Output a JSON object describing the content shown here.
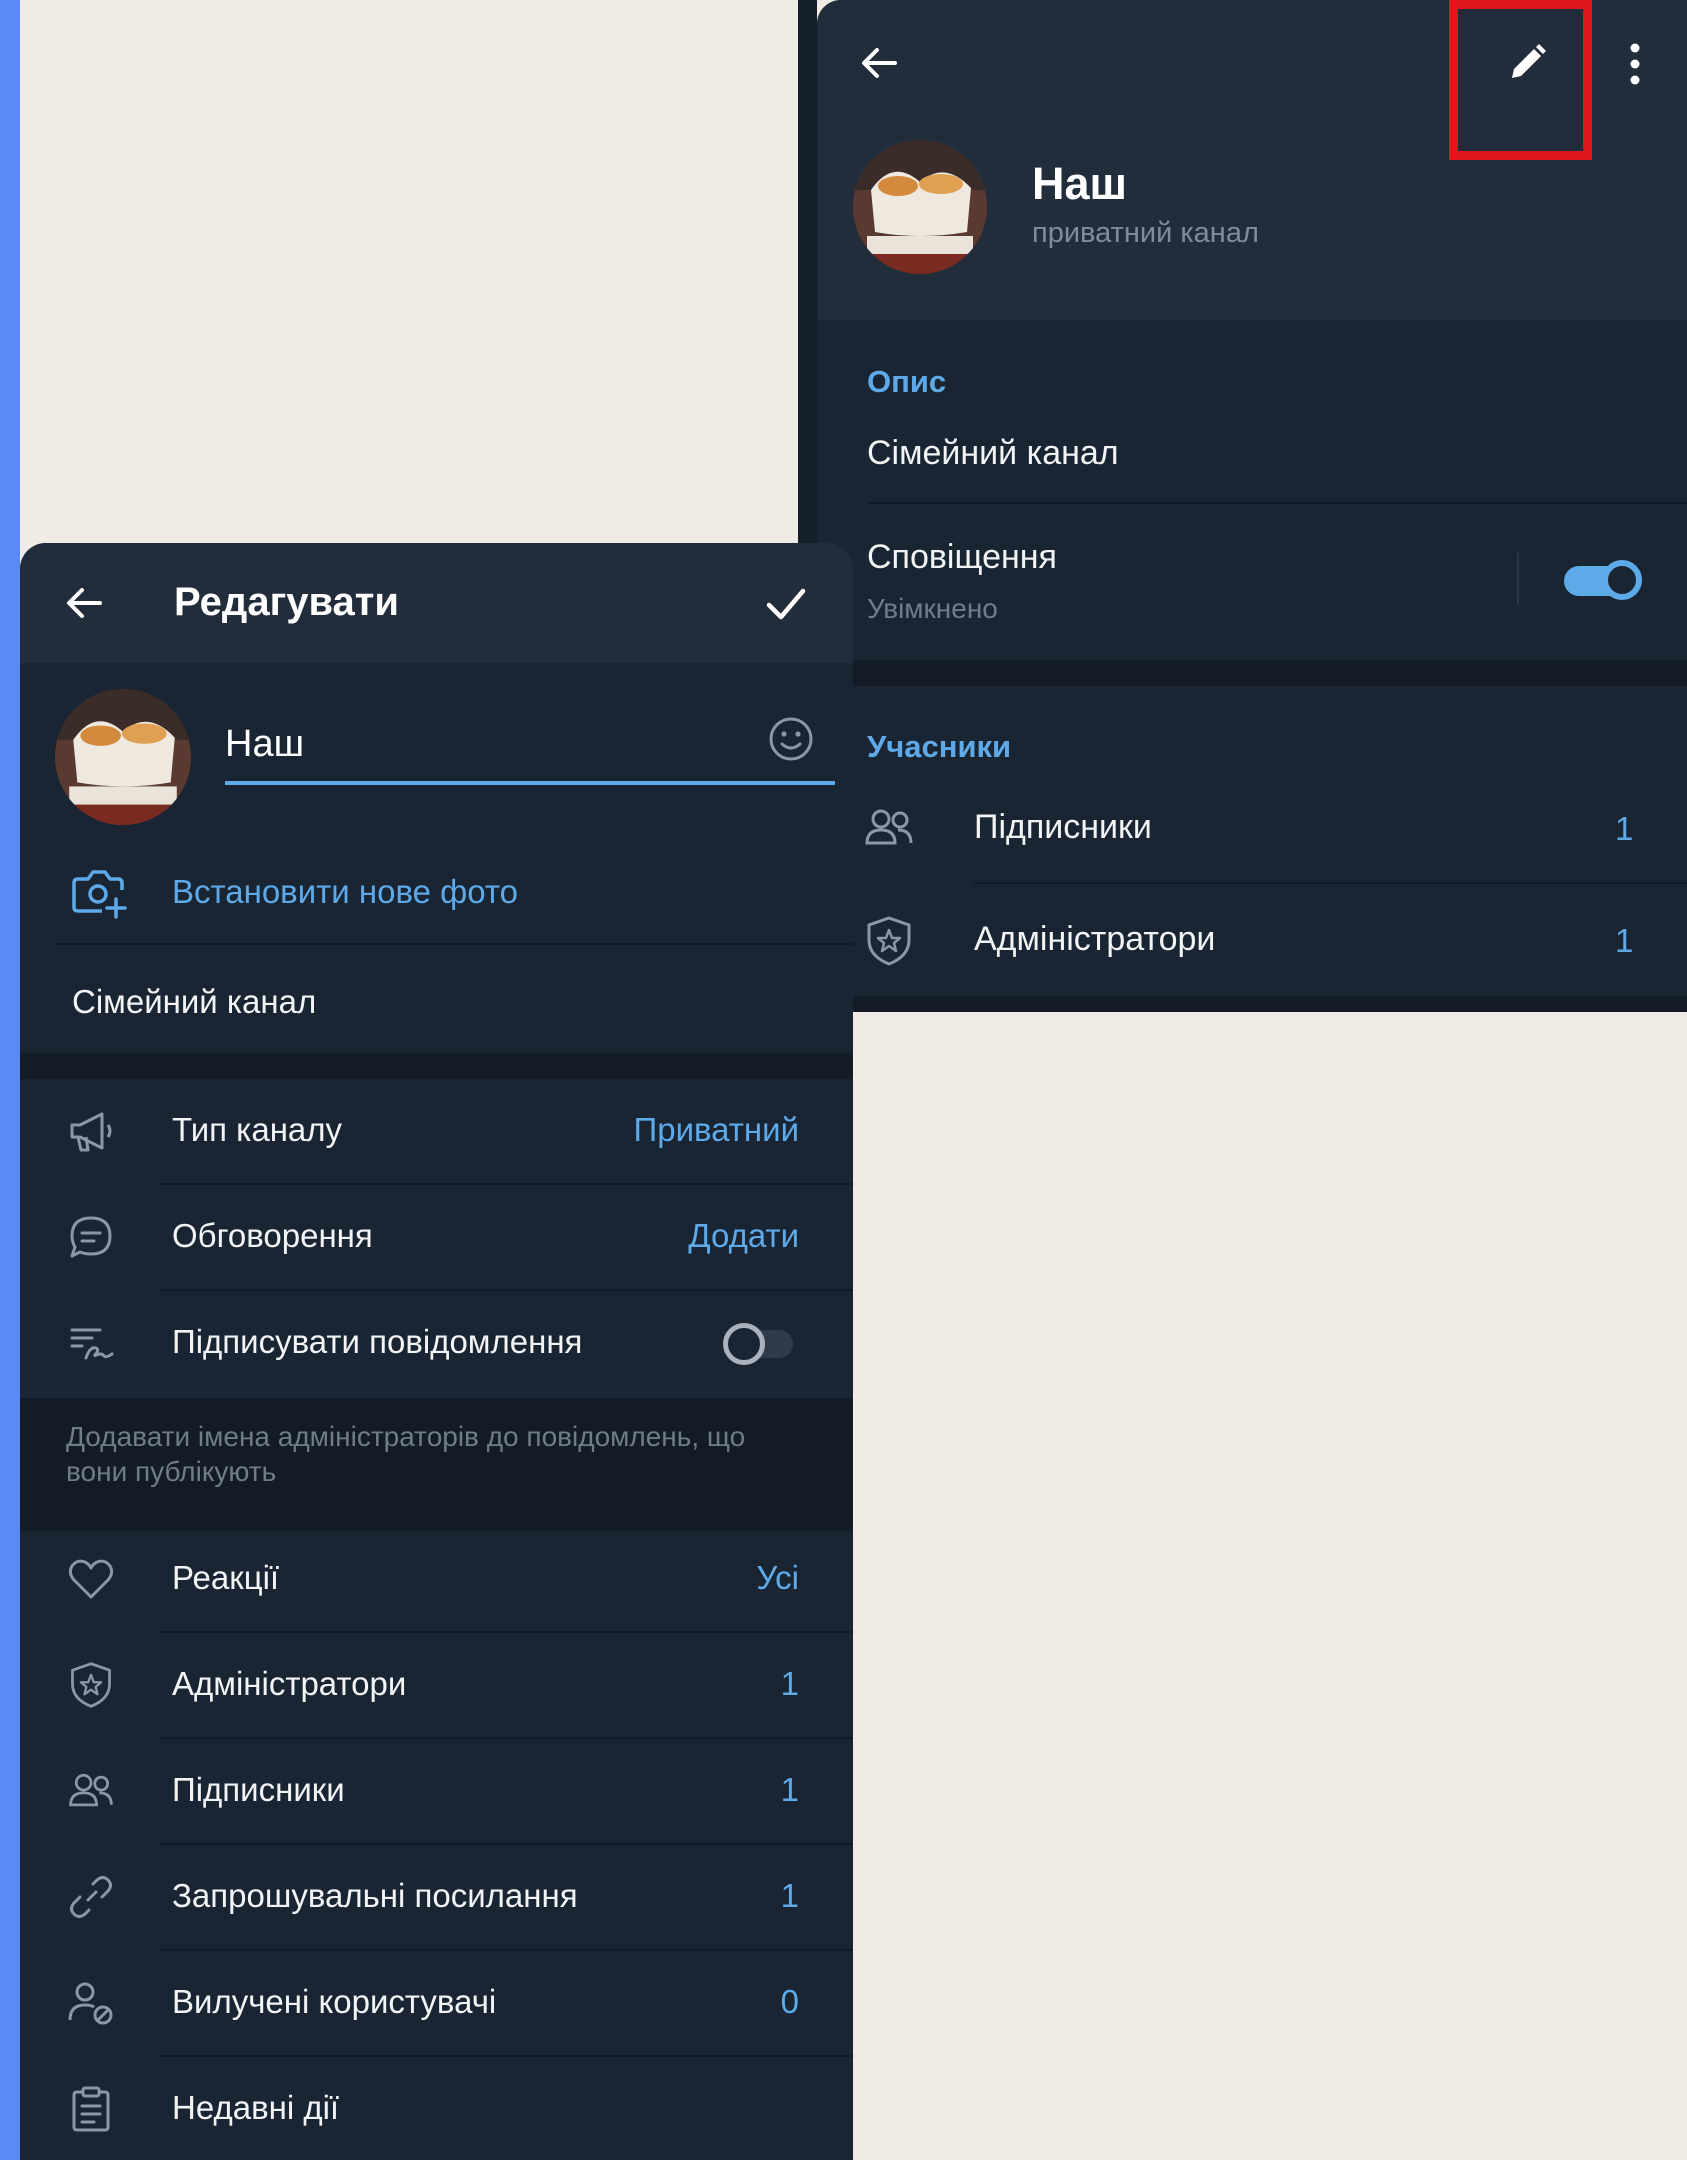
{
  "channel_info": {
    "name": "Наш",
    "subtitle": "приватний канал",
    "description_title": "Опис",
    "description": "Сімейний канал",
    "notifications_label": "Сповіщення",
    "notifications_status": "Увімкнено",
    "notifications_enabled": true,
    "members_title": "Учасники",
    "rows": [
      {
        "label": "Підписники",
        "count": "1",
        "icon": "subscribers-icon"
      },
      {
        "label": "Адміністратори",
        "count": "1",
        "icon": "admin-shield-icon"
      }
    ]
  },
  "edit_screen": {
    "title": "Редагувати",
    "name_value": "Наш",
    "set_photo_label": "Встановити нове фото",
    "description_value": "Сімейний канал",
    "settings": [
      {
        "label": "Тип каналу",
        "value": "Приватний",
        "icon": "megaphone-icon"
      },
      {
        "label": "Обговорення",
        "value": "Додати",
        "icon": "discussion-icon"
      },
      {
        "label": "Підписувати повідомлення",
        "value": "",
        "icon": "sign-messages-icon"
      }
    ],
    "sign_messages_enabled": false,
    "sign_messages_hint": "Додавати імена адміністраторів до повідомлень, що вони публікують",
    "items": [
      {
        "label": "Реакції",
        "value": "Усі",
        "icon": "heart-icon"
      },
      {
        "label": "Адміністратори",
        "value": "1",
        "icon": "admin-shield-icon"
      },
      {
        "label": "Підписники",
        "value": "1",
        "icon": "subscribers-icon"
      },
      {
        "label": "Запрошувальні посилання",
        "value": "1",
        "icon": "link-icon"
      },
      {
        "label": "Вилучені користувачі",
        "value": "0",
        "icon": "removed-users-icon"
      },
      {
        "label": "Недавні дії",
        "value": "",
        "icon": "recent-actions-icon"
      }
    ]
  },
  "colors": {
    "accent": "#5ea9e8",
    "panel_bg": "#1a2533",
    "header_bg": "#212d3b",
    "highlight": "#e0171c",
    "page_bg": "#f0ebe5",
    "left_strip": "#5b8af5"
  }
}
